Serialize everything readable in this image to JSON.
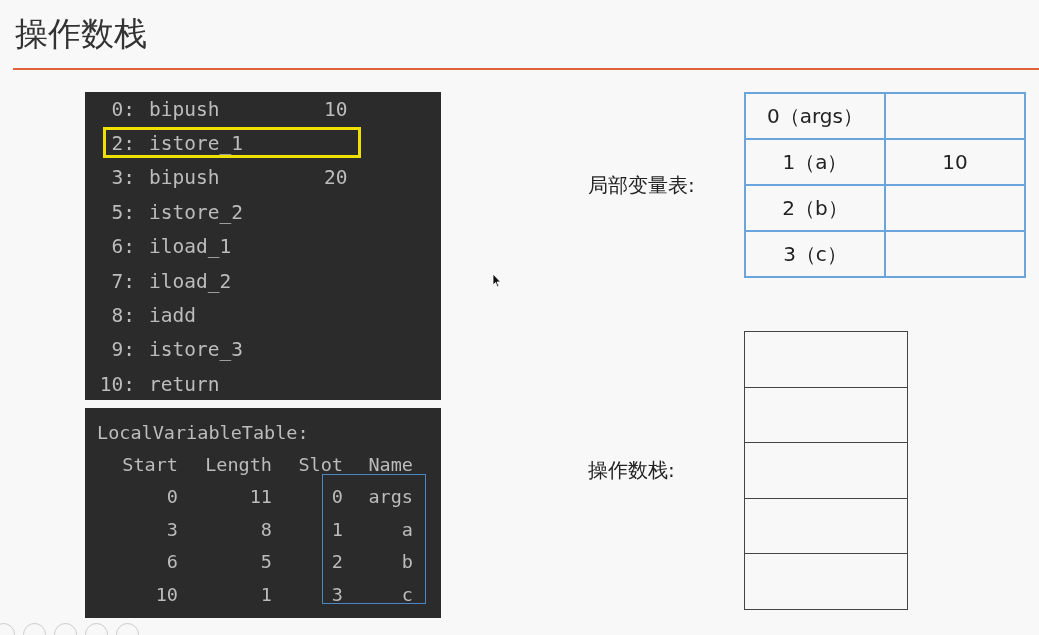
{
  "slide": {
    "title": "操作数栈"
  },
  "bytecode": [
    {
      "offset": "0:",
      "instruction": "bipush",
      "operand": "10",
      "selected": false
    },
    {
      "offset": "2:",
      "instruction": "istore_1",
      "selected": true
    },
    {
      "offset": "3:",
      "instruction": "bipush",
      "operand": "20",
      "selected": false
    },
    {
      "offset": "5:",
      "instruction": "istore_2",
      "selected": false
    },
    {
      "offset": "6:",
      "instruction": "iload_1",
      "selected": false
    },
    {
      "offset": "7:",
      "instruction": "iload_2",
      "selected": false
    },
    {
      "offset": "8:",
      "instruction": "iadd",
      "selected": false
    },
    {
      "offset": "9:",
      "instruction": "istore_3",
      "selected": false
    },
    {
      "offset": "10:",
      "instruction": "return",
      "selected": false
    }
  ],
  "local_variable_table_listing": {
    "title": "LocalVariableTable:",
    "columns": [
      "Start",
      "Length",
      "Slot",
      "Name"
    ],
    "rows": [
      [
        "0",
        "11",
        "0",
        "args"
      ],
      [
        "3",
        "8",
        "1",
        "a"
      ],
      [
        "6",
        "5",
        "2",
        "b"
      ],
      [
        "10",
        "1",
        "3",
        "c"
      ]
    ]
  },
  "local_variables": {
    "label": "局部变量表:",
    "rows": [
      {
        "slot": "0（args）"
      },
      {
        "slot": "1（a）",
        "value": "10"
      },
      {
        "slot": "2（b）"
      },
      {
        "slot": "3（c）"
      }
    ]
  },
  "operand_stack": {
    "label": "操作数栈:"
  }
}
